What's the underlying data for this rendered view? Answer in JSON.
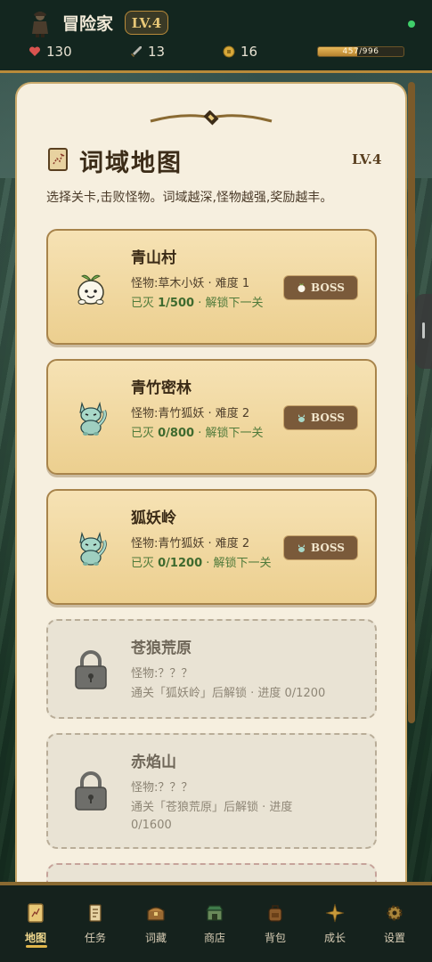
{
  "header": {
    "name": "冒险家",
    "level": "LV.4",
    "hp": "130",
    "attack": "13",
    "coins": "16",
    "xp_text": "457/996",
    "xp_fraction": 0.46
  },
  "panel": {
    "title": "词域地图",
    "level": "LV.4",
    "description": "选择关卡,击败怪物。词域越深,怪物越强,奖励越丰。"
  },
  "stages": [
    {
      "name": "青山村",
      "info": "怪物:草木小妖 · 难度 1",
      "progress_prefix": "已灭 ",
      "progress_count": "1/500",
      "progress_suffix": " · 解锁下一关",
      "boss_label": "BOSS",
      "monster_icon": "sprout-spirit-icon"
    },
    {
      "name": "青竹密林",
      "info": "怪物:青竹狐妖 · 难度 2",
      "progress_prefix": "已灭 ",
      "progress_count": "0/800",
      "progress_suffix": " · 解锁下一关",
      "boss_label": "BOSS",
      "monster_icon": "fox-spirit-icon"
    },
    {
      "name": "狐妖岭",
      "info": "怪物:青竹狐妖 · 难度 2",
      "progress_prefix": "已灭 ",
      "progress_count": "0/1200",
      "progress_suffix": " · 解锁下一关",
      "boss_label": "BOSS",
      "monster_icon": "fox-spirit-icon"
    },
    {
      "name": "苍狼荒原",
      "info": "怪物:？？？",
      "requirement": "通关「狐妖岭」后解锁 · 进度 0/1200",
      "locked": true
    },
    {
      "name": "赤焰山",
      "info": "怪物:？？？",
      "requirement": "通关「苍狼荒原」后解锁 · 进度 0/1600",
      "locked": true
    }
  ],
  "nav": [
    {
      "label": "地图",
      "icon": "map-scroll-icon",
      "active": true
    },
    {
      "label": "任务",
      "icon": "quest-scroll-icon"
    },
    {
      "label": "词藏",
      "icon": "treasure-chest-icon"
    },
    {
      "label": "商店",
      "icon": "shop-stall-icon"
    },
    {
      "label": "背包",
      "icon": "backpack-icon"
    },
    {
      "label": "成长",
      "icon": "sparkle-star-icon"
    },
    {
      "label": "设置",
      "icon": "gear-icon"
    }
  ],
  "colors": {
    "accent_gold": "#b88a3a",
    "panel_bg": "#f6efdf",
    "card_gold": "#eccf8f",
    "progress_green": "#4f7a3a"
  }
}
